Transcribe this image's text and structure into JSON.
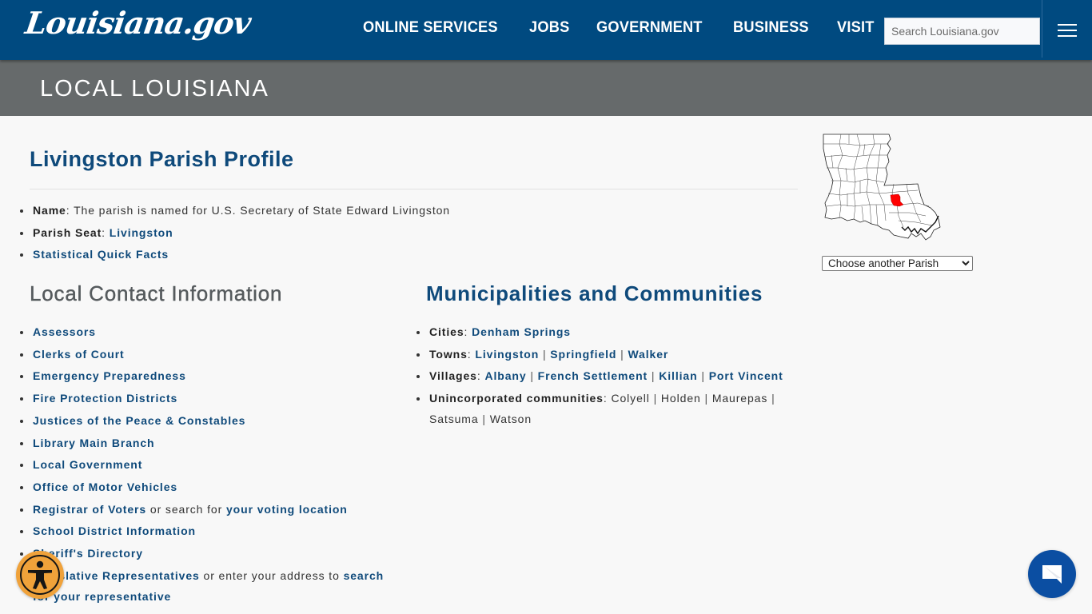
{
  "header": {
    "logo_text": "Louisiana.gov",
    "nav": [
      {
        "label": "ONLINE SERVICES"
      },
      {
        "label": "JOBS"
      },
      {
        "label": "GOVERNMENT"
      },
      {
        "label": "BUSINESS"
      },
      {
        "label": "VISIT"
      }
    ],
    "search_placeholder": "Search Louisiana.gov",
    "menu_icon": "hamburger-menu-icon"
  },
  "banner": {
    "title": "LOCAL LOUISIANA"
  },
  "profile": {
    "title": "Livingston Parish Profile",
    "name_label": "Name",
    "name_text": "The parish is named for U.S. Secretary of State Edward Livingston",
    "seat_label": "Parish Seat",
    "seat_link": "Livingston",
    "quick_facts_link": "Statistical Quick Facts"
  },
  "contact": {
    "heading": "Local Contact Information",
    "links": [
      "Assessors",
      "Clerks of Court",
      "Emergency Preparedness",
      "Fire Protection Districts",
      "Justices of the Peace & Constables",
      "Library Main Branch",
      "Local Government",
      "Office of Motor Vehicles"
    ],
    "registrar_link": "Registrar of Voters",
    "registrar_text": " or search for ",
    "voting_link": "your voting location",
    "school_link": "School District Information",
    "sheriff_link": "Sheriff's Directory",
    "reps_link": "Legislative Representatives",
    "reps_text": " or enter your address to ",
    "reps_search_link": "search for your representative"
  },
  "municipalities": {
    "heading": "Municipalities and Communities",
    "cities_label": "Cities",
    "cities": [
      "Denham Springs"
    ],
    "towns_label": "Towns",
    "towns": [
      "Livingston",
      "Springfield",
      "Walker"
    ],
    "villages_label": "Villages",
    "villages": [
      "Albany",
      "French Settlement",
      "Killian",
      "Port Vincent"
    ],
    "unincorporated_label": "Unincorporated communities",
    "unincorporated": [
      "Colyell",
      "Holden",
      "Maurepas",
      "Satsuma",
      "Watson"
    ],
    "separator": " | "
  },
  "sidebar": {
    "map_icon": "louisiana-parish-map",
    "highlight_color": "#ff0000",
    "select_value": "Choose another Parish"
  },
  "widgets": {
    "accessibility_icon": "accessibility-icon",
    "chat_icon": "chat-icon"
  },
  "colors": {
    "header_bg": "#004a80",
    "banner_bg": "#666a6b",
    "link": "#0f4a7b",
    "accessibility_bg": "#f0a23a",
    "chat_bg": "#0b4ea2"
  }
}
